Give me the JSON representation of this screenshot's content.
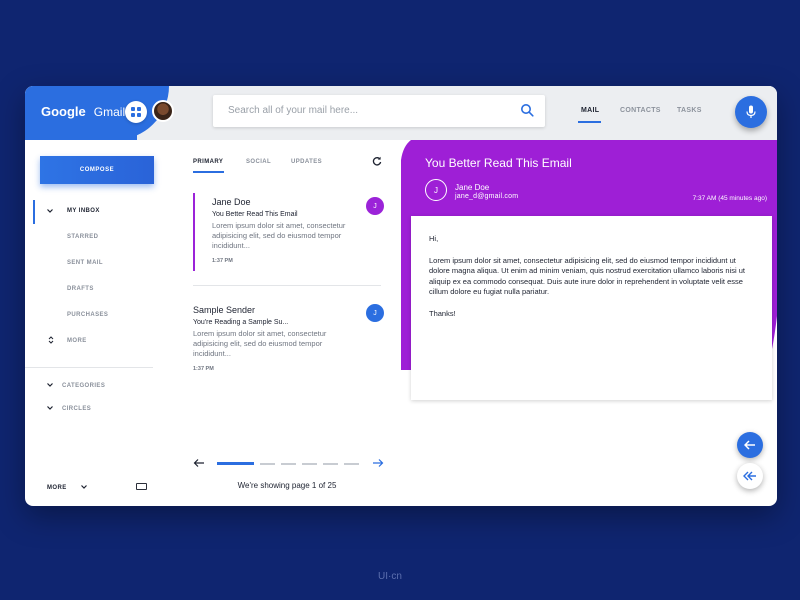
{
  "brand": {
    "google": "Google",
    "gmail": "Gmail"
  },
  "search": {
    "placeholder": "Search all of your mail here..."
  },
  "topnav": [
    {
      "label": "MAIL",
      "active": true
    },
    {
      "label": "CONTACTS",
      "active": false
    },
    {
      "label": "TASKS",
      "active": false
    }
  ],
  "sidebar": {
    "compose_label": "COMPOSE",
    "items": [
      "MY INBOX",
      "STARRED",
      "SENT MAIL",
      "DRAFTS",
      "PURCHASES",
      "MORE"
    ],
    "groups": [
      "CATEGORIES",
      "CIRCLES"
    ],
    "footer_more": "MORE"
  },
  "tabs": [
    "PRIMARY",
    "SOCIAL",
    "UPDATES"
  ],
  "emails": [
    {
      "sender": "Jane Doe",
      "subject": "You Better Read This Email",
      "preview": "Lorem ipsum dolor sit amet, consectetur adipisicing elit, sed do eiusmod tempor incididunt...",
      "time": "1:37 PM",
      "initial": "J"
    },
    {
      "sender": "Sample Sender",
      "subject": "You're Reading a Sample Su...",
      "preview": "Lorem ipsum dolor sit amet, consectetur adipisicing elit, sed do eiusmod tempor incididunt...",
      "time": "1:37 PM",
      "initial": "J"
    }
  ],
  "pager": {
    "text": "We're showing page 1 of 25"
  },
  "reading": {
    "title": "You Better Read This Email",
    "from_name": "Jane Doe",
    "from_email": "jane_d@gmail.com",
    "initial": "J",
    "date": "7:37 AM (45 minutes ago)",
    "greeting": "Hi,",
    "body": "Lorem ipsum dolor sit amet, consectetur adipisicing elit, sed do eiusmod tempor incididunt ut dolore magna aliqua. Ut enim ad minim veniam, quis nostrud exercitation ullamco laboris nisi ut aliquip ex ea commodo consequat. Duis aute irure dolor in reprehendent in voluptate velit esse cillum dolore eu fugiat nulla pariatur.",
    "signoff": "Thanks!"
  },
  "colors": {
    "accent": "#2b6ee0",
    "purple": "#9e1fd6",
    "background": "#0f2570"
  },
  "watermark": "UI·cn"
}
